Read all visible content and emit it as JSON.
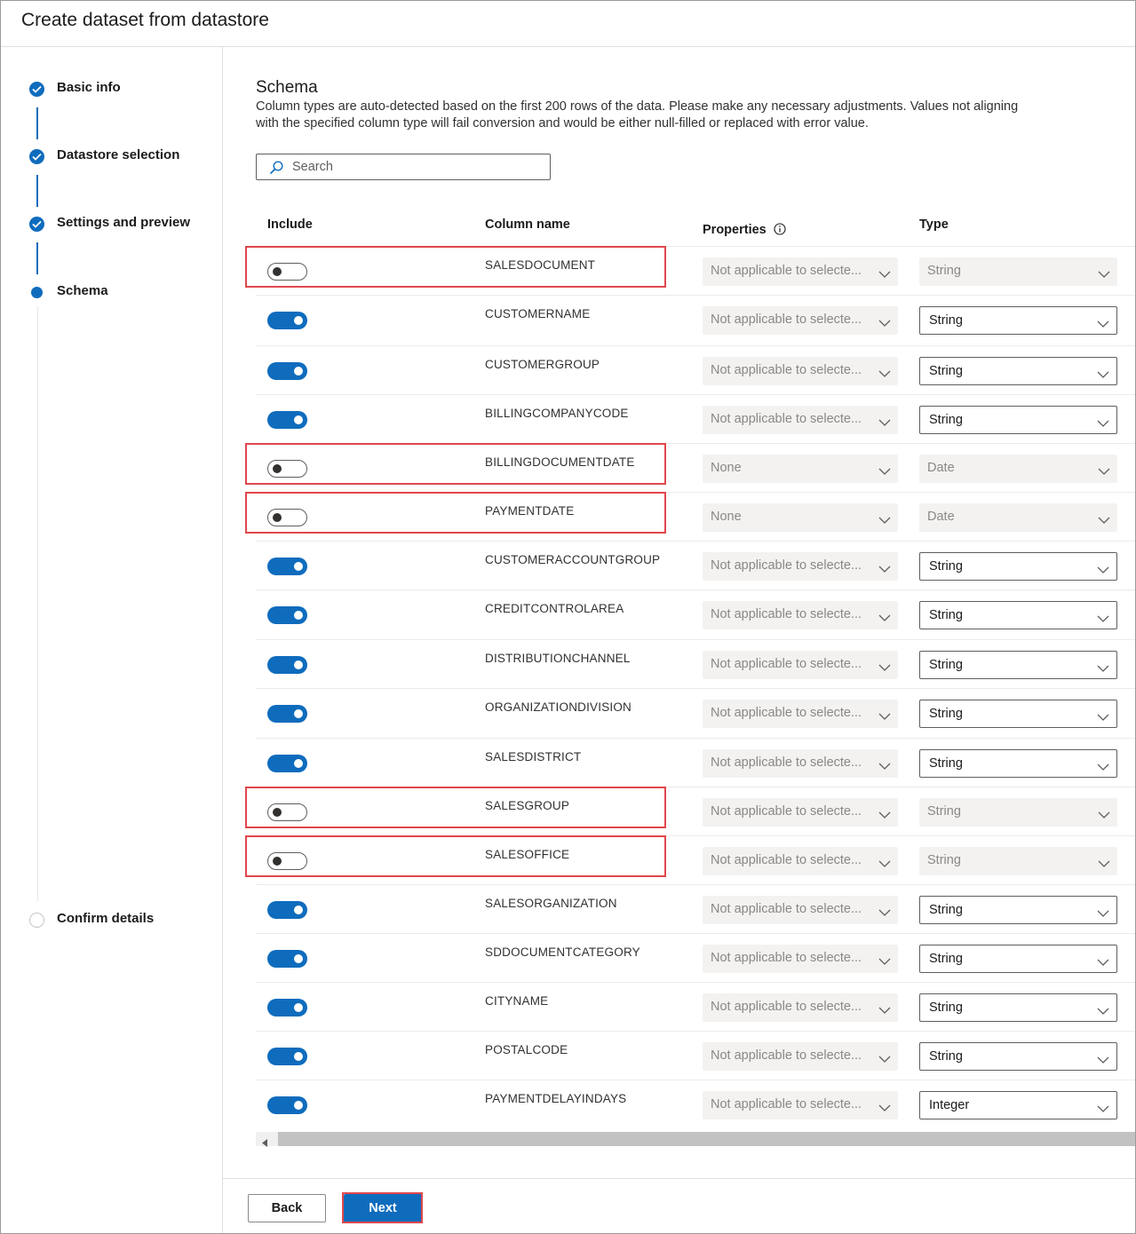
{
  "window": {
    "title": "Create dataset from datastore"
  },
  "steps": [
    {
      "label": "Basic info",
      "state": "complete"
    },
    {
      "label": "Datastore selection",
      "state": "complete"
    },
    {
      "label": "Settings and preview",
      "state": "complete"
    },
    {
      "label": "Schema",
      "state": "current"
    },
    {
      "label": "Confirm details",
      "state": "pending"
    }
  ],
  "schema": {
    "title": "Schema",
    "description": "Column types are auto-detected based on the first 200 rows of the data. Please make any necessary adjustments. Values not aligning with the specified column type will fail conversion and would be either null-filled or replaced with error value.",
    "search_placeholder": "Search",
    "headers": {
      "include": "Include",
      "column_name": "Column name",
      "properties": "Properties",
      "type": "Type"
    },
    "rows": [
      {
        "include": false,
        "name": "SALESDOCUMENT",
        "properties": "Not applicable to selecte...",
        "type": "String",
        "highlighted": true
      },
      {
        "include": true,
        "name": "CUSTOMERNAME",
        "properties": "Not applicable to selecte...",
        "type": "String",
        "highlighted": false
      },
      {
        "include": true,
        "name": "CUSTOMERGROUP",
        "properties": "Not applicable to selecte...",
        "type": "String",
        "highlighted": false
      },
      {
        "include": true,
        "name": "BILLINGCOMPANYCODE",
        "properties": "Not applicable to selecte...",
        "type": "String",
        "highlighted": false
      },
      {
        "include": false,
        "name": "BILLINGDOCUMENTDATE",
        "properties": "None",
        "type": "Date",
        "highlighted": true
      },
      {
        "include": false,
        "name": "PAYMENTDATE",
        "properties": "None",
        "type": "Date",
        "highlighted": true
      },
      {
        "include": true,
        "name": "CUSTOMERACCOUNTGROUP",
        "properties": "Not applicable to selecte...",
        "type": "String",
        "highlighted": false
      },
      {
        "include": true,
        "name": "CREDITCONTROLAREA",
        "properties": "Not applicable to selecte...",
        "type": "String",
        "highlighted": false
      },
      {
        "include": true,
        "name": "DISTRIBUTIONCHANNEL",
        "properties": "Not applicable to selecte...",
        "type": "String",
        "highlighted": false
      },
      {
        "include": true,
        "name": "ORGANIZATIONDIVISION",
        "properties": "Not applicable to selecte...",
        "type": "String",
        "highlighted": false
      },
      {
        "include": true,
        "name": "SALESDISTRICT",
        "properties": "Not applicable to selecte...",
        "type": "String",
        "highlighted": false
      },
      {
        "include": false,
        "name": "SALESGROUP",
        "properties": "Not applicable to selecte...",
        "type": "String",
        "highlighted": true
      },
      {
        "include": false,
        "name": "SALESOFFICE",
        "properties": "Not applicable to selecte...",
        "type": "String",
        "highlighted": true
      },
      {
        "include": true,
        "name": "SALESORGANIZATION",
        "properties": "Not applicable to selecte...",
        "type": "String",
        "highlighted": false
      },
      {
        "include": true,
        "name": "SDDOCUMENTCATEGORY",
        "properties": "Not applicable to selecte...",
        "type": "String",
        "highlighted": false
      },
      {
        "include": true,
        "name": "CITYNAME",
        "properties": "Not applicable to selecte...",
        "type": "String",
        "highlighted": false
      },
      {
        "include": true,
        "name": "POSTALCODE",
        "properties": "Not applicable to selecte...",
        "type": "String",
        "highlighted": false
      },
      {
        "include": true,
        "name": "PAYMENTDELAYINDAYS",
        "properties": "Not applicable to selecte...",
        "type": "Integer",
        "highlighted": false
      }
    ]
  },
  "footer": {
    "back_label": "Back",
    "next_label": "Next"
  },
  "colors": {
    "accent": "#0f6cbd",
    "highlight": "#e0474c"
  }
}
